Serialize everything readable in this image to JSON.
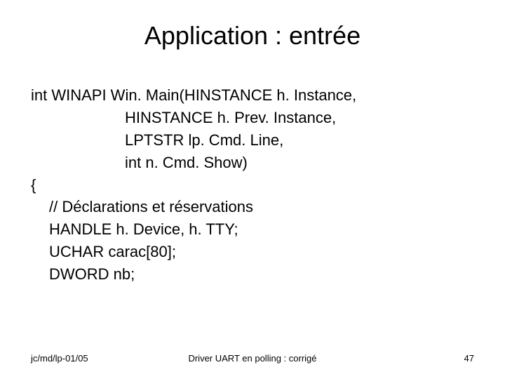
{
  "title": "Application : entrée",
  "code": {
    "l1": "int WINAPI Win. Main(HINSTANCE h. Instance,",
    "l2": "HINSTANCE h. Prev. Instance,",
    "l3": "LPTSTR lp. Cmd. Line,",
    "l4": "int n. Cmd. Show)",
    "l5": "{",
    "l6": "// Déclarations et réservations",
    "l7": "HANDLE h. Device, h. TTY;",
    "l8": "UCHAR carac[80];",
    "l9": "DWORD nb;"
  },
  "footer": {
    "left": "jc/md/lp-01/05",
    "center": "Driver UART en polling : corrigé",
    "right": "47"
  }
}
